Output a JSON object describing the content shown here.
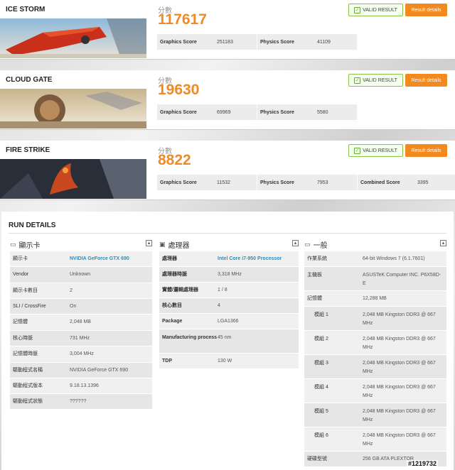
{
  "benchmarks": [
    {
      "name": "ICE STORM",
      "score_label": "分數",
      "score": "117617",
      "valid_label": "VALID RESULT",
      "details_label": "Result details",
      "sub": [
        {
          "k": "Graphics Score",
          "v": "251183"
        },
        {
          "k": "Physics Score",
          "v": "41109"
        }
      ]
    },
    {
      "name": "CLOUD GATE",
      "score_label": "分數",
      "score": "19630",
      "valid_label": "VALID RESULT",
      "details_label": "Result details",
      "sub": [
        {
          "k": "Graphics Score",
          "v": "69969"
        },
        {
          "k": "Physics Score",
          "v": "5580"
        }
      ]
    },
    {
      "name": "FIRE STRIKE",
      "score_label": "分數",
      "score": "8822",
      "valid_label": "VALID RESULT",
      "details_label": "Result details",
      "sub": [
        {
          "k": "Graphics Score",
          "v": "11532"
        },
        {
          "k": "Physics Score",
          "v": "7953"
        },
        {
          "k": "Combined Score",
          "v": "3395"
        }
      ]
    }
  ],
  "run_details": {
    "title": "RUN DETAILS",
    "gpu": {
      "heading": "顯示卡",
      "rows": [
        {
          "k": "顯示卡",
          "v": "NVIDIA GeForce GTX 690"
        },
        {
          "k": "Vendor",
          "v": "Unknown"
        },
        {
          "k": "顯示卡數目",
          "v": "2"
        },
        {
          "k": "SLI / CrossFire",
          "v": "On"
        },
        {
          "k": "記憶體",
          "v": "2,048 MB"
        },
        {
          "k": "核心時脈",
          "v": "731 MHz"
        },
        {
          "k": "記憶體時脈",
          "v": "3,004 MHz"
        },
        {
          "k": "驅動程式名稱",
          "v": "NVIDIA GeForce GTX 690"
        },
        {
          "k": "驅動程式版本",
          "v": "9.18.13.1396"
        },
        {
          "k": "驅動程式狀態",
          "v": "??????"
        }
      ]
    },
    "cpu": {
      "heading": "處理器",
      "rows": [
        {
          "k": "處理器",
          "v": "Intel Core i7-950 Processor"
        },
        {
          "k": "處理器時脈",
          "v": "3,318 MHz"
        },
        {
          "k": "實體/邏輯處理器",
          "v": "1 / 8"
        },
        {
          "k": "核心數目",
          "v": "4"
        },
        {
          "k": "Package",
          "v": "LGA1366"
        },
        {
          "k": "Manufacturing process",
          "v": "45 nm"
        },
        {
          "k": "TDP",
          "v": "130 W"
        }
      ]
    },
    "general": {
      "heading": "一般",
      "rows": [
        {
          "k": "作業系統",
          "v": "64-bit Windows 7 (6.1.7601)"
        },
        {
          "k": "主機板",
          "v": "ASUSTeK Computer INC. P6X58D-E"
        },
        {
          "k": "記憶體",
          "v": "12,288 MB"
        },
        {
          "k": "模組 1",
          "v": "2,048 MB Kingston DDR3 @ 667 MHz"
        },
        {
          "k": "模組 2",
          "v": "2,048 MB Kingston DDR3 @ 667 MHz"
        },
        {
          "k": "模組 3",
          "v": "2,048 MB Kingston DDR3 @ 667 MHz"
        },
        {
          "k": "模組 4",
          "v": "2,048 MB Kingston DDR3 @ 667 MHz"
        },
        {
          "k": "模組 5",
          "v": "2,048 MB Kingston DDR3 @ 667 MHz"
        },
        {
          "k": "模組 6",
          "v": "2,048 MB Kingston DDR3 @ 667 MHz"
        },
        {
          "k": "硬碟型號",
          "v": "256 GB ATA PLEXTOR"
        }
      ]
    }
  },
  "watermark": "#1219732",
  "colors": {
    "accent": "#f08a24",
    "valid": "#8bc34a",
    "link": "#2a8fbd"
  }
}
